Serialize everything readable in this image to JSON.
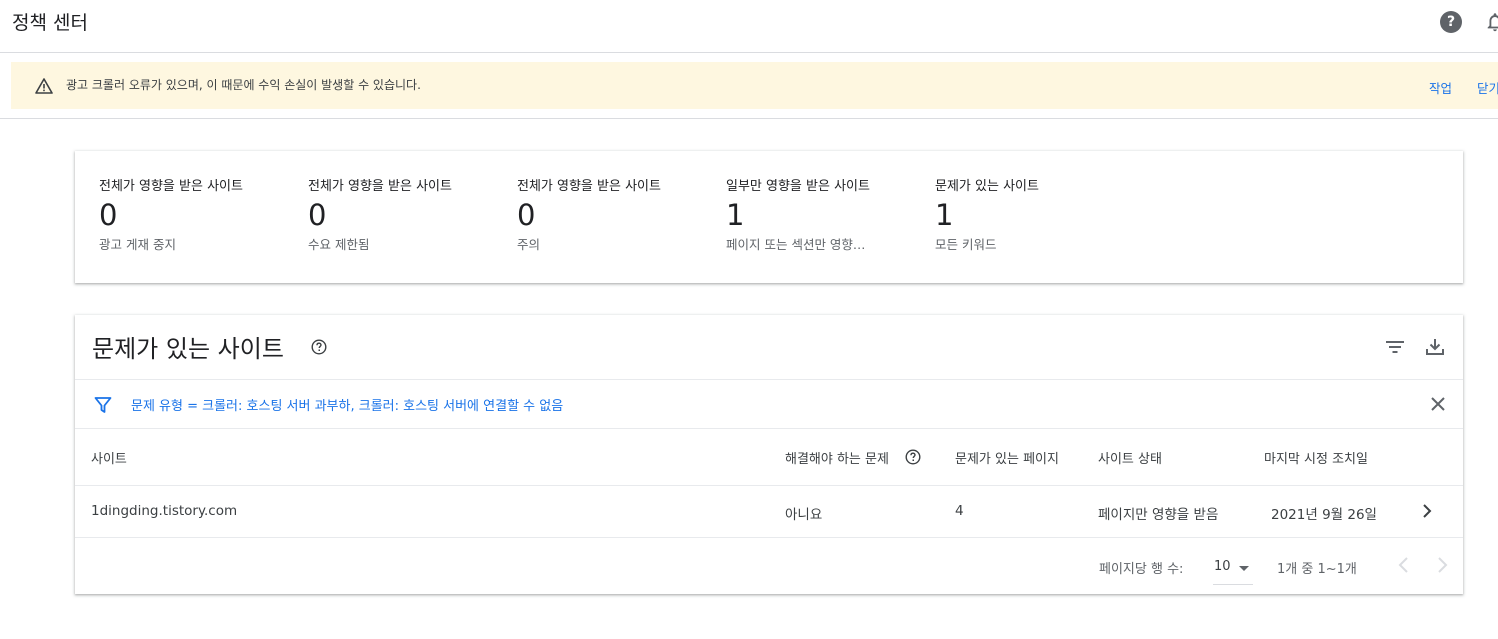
{
  "header": {
    "title": "정책 센터",
    "help_icon": "help-circle-icon",
    "bell_icon": "notifications-bell-icon"
  },
  "banner": {
    "icon": "warning-triangle-icon",
    "message": "광고 크롤러 오류가 있으며, 이 때문에 수익 손실이 발생할 수 있습니다.",
    "action_label": "작업",
    "close_label": "닫기",
    "background": "#fef7e0"
  },
  "summary": [
    {
      "label": "전체가 영향을 받은 사이트",
      "value": "0",
      "sub": "광고 게재 중지"
    },
    {
      "label": "전체가 영향을 받은 사이트",
      "value": "0",
      "sub": "수요 제한됨"
    },
    {
      "label": "전체가 영향을 받은 사이트",
      "value": "0",
      "sub": "주의"
    },
    {
      "label": "일부만 영향을 받은 사이트",
      "value": "1",
      "sub": "페이지 또는 섹션만 영향…"
    },
    {
      "label": "문제가 있는 사이트",
      "value": "1",
      "sub": "모든 키워드"
    }
  ],
  "sites": {
    "title": "문제가 있는 사이트",
    "filter_text": "문제 유형 = 크롤러: 호스팅 서버 과부하, 크롤러: 호스팅 서버에 연결할 수 없음",
    "columns": {
      "site": "사이트",
      "needs_fix": "해결해야 하는 문제",
      "pages": "문제가 있는 페이지",
      "status": "사이트 상태",
      "last_action": "마지막 시정 조치일"
    },
    "rows": [
      {
        "site": "1dingding.tistory.com",
        "needs_fix": "아니요",
        "pages": "4",
        "status": "페이지만 영향을 받음",
        "last_action": "2021년 9월 26일"
      }
    ],
    "pagination": {
      "rows_per_page_label": "페이지당 행 수:",
      "rows_per_page": "10",
      "range": "1개 중 1~1개"
    }
  },
  "colors": {
    "accent": "#1a73e8",
    "text": "#202124",
    "muted": "#5f6368"
  }
}
